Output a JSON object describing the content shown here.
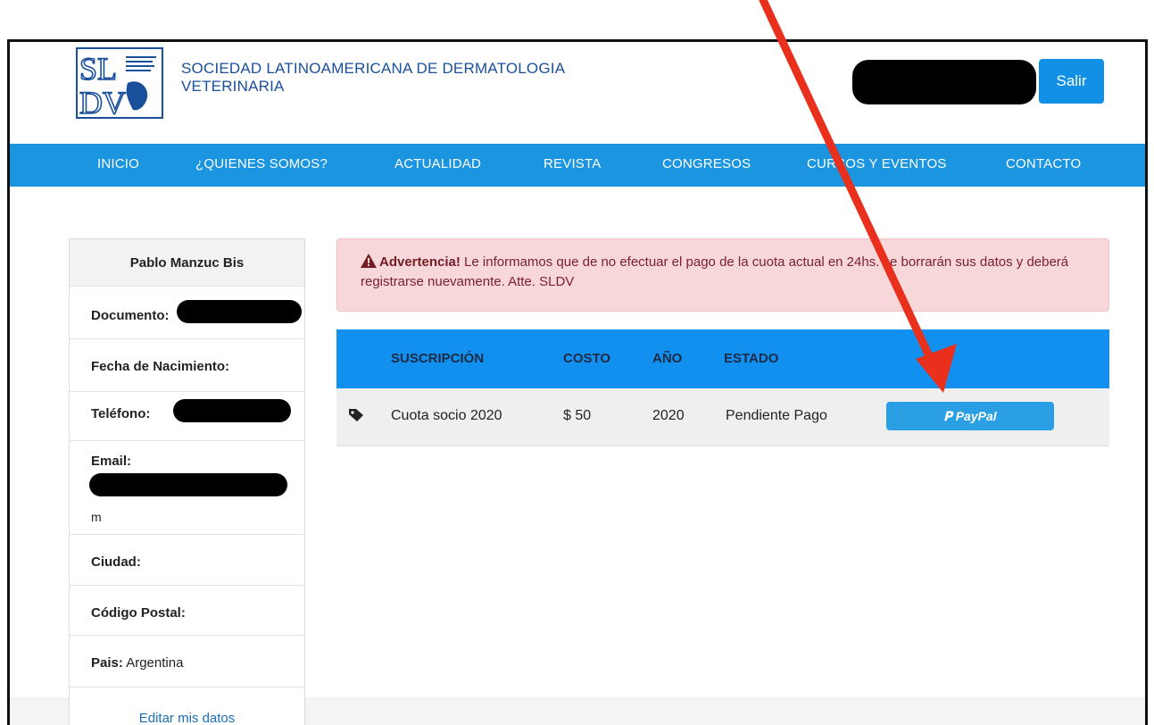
{
  "header": {
    "org_line1": "SOCIEDAD LATINOAMERICANA DE DERMATOLOGIA",
    "org_line2": "VETERINARIA",
    "logout_label": "Salir"
  },
  "nav": {
    "items": [
      "INICIO",
      "¿QUIENES SOMOS?",
      "ACTUALIDAD",
      "REVISTA",
      "CONGRESOS",
      "CURSOS Y EVENTOS",
      "CONTACTO"
    ]
  },
  "profile": {
    "name": "Pablo Manzuc Bis",
    "documento_label": "Documento:",
    "fecha_label": "Fecha de Nacimiento:",
    "telefono_label": "Teléfono:",
    "email_label": "Email:",
    "email_tail": "m",
    "ciudad_label": "Ciudad:",
    "codigo_label": "Código Postal:",
    "pais_label": "Pais:",
    "pais_value": "Argentina",
    "edit_link": "Editar mis datos"
  },
  "alert": {
    "strong": "Advertencia!",
    "message": "Le informamos que de no efectuar el pago de la cuota actual en 24hs. se borrarán sus datos y deberá registrarse nuevamente. Atte. SLDV"
  },
  "table": {
    "headers": [
      "SUSCRIPCIÓN",
      "COSTO",
      "AÑO",
      "ESTADO"
    ],
    "rows": [
      {
        "suscripcion": "Cuota socio 2020",
        "costo": "$ 50",
        "anio": "2020",
        "estado": "Pendiente Pago",
        "action": "PayPal"
      }
    ]
  },
  "colors": {
    "nav_blue": "#1b95e0",
    "brand_blue": "#1a4f9c",
    "alert_bg": "#f8d7da",
    "paypal_blue": "#2b9fe3",
    "arrow_red": "#e8301c"
  }
}
